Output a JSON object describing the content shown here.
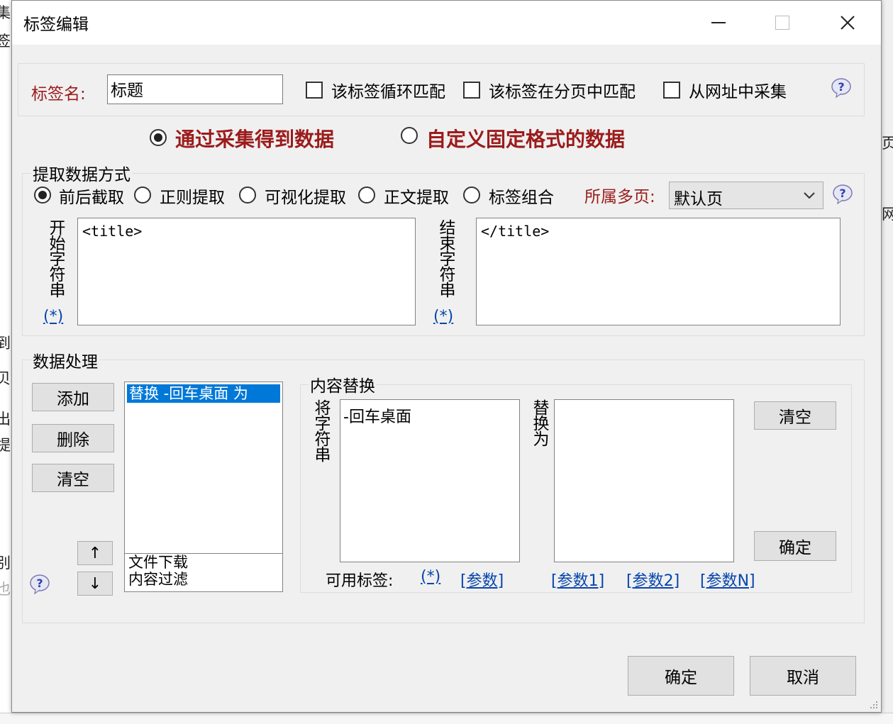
{
  "background": {
    "left_fragments": [
      "集I",
      "签",
      "到",
      "贝",
      "出",
      "提",
      "别",
      "也"
    ],
    "right_fragments": [
      "页",
      "网"
    ]
  },
  "window": {
    "title": "标签编辑",
    "controls": {
      "minimize": "–",
      "maximize": "☐",
      "close": "✕"
    }
  },
  "tag_row": {
    "label": "标签名:",
    "value": "标题",
    "checkboxes": [
      {
        "label": "该标签循环匹配",
        "checked": false
      },
      {
        "label": "该标签在分页中匹配",
        "checked": false
      },
      {
        "label": "从网址中采集",
        "checked": false
      }
    ]
  },
  "mode": {
    "options": [
      {
        "label": "通过采集得到数据",
        "selected": true
      },
      {
        "label": "自定义固定格式的数据",
        "selected": false
      }
    ],
    "accent_color": "#9b1b1b"
  },
  "extract": {
    "group_label": "提取数据方式",
    "methods": [
      {
        "label": "前后截取",
        "selected": true
      },
      {
        "label": "正则提取",
        "selected": false
      },
      {
        "label": "可视化提取",
        "selected": false
      },
      {
        "label": "正文提取",
        "selected": false
      },
      {
        "label": "标签组合",
        "selected": false
      }
    ],
    "page_label": "所属多页:",
    "page_value": "默认页",
    "start_label": "开始字符串",
    "start_value": "<title>",
    "start_link": "(*)",
    "end_label": "结束字符串",
    "end_value": "</title>",
    "end_link": "(*)"
  },
  "processing": {
    "group_label": "数据处理",
    "buttons": {
      "add": "添加",
      "delete": "删除",
      "clear": "清空"
    },
    "rules": [
      "替换 -回车桌面 为"
    ],
    "options": [
      "文件下载",
      "内容过滤"
    ],
    "up_arrow": "↑",
    "down_arrow": "↓",
    "replace": {
      "group_label": "内容替换",
      "find_label": "将字符串",
      "find_value": "-回车桌面",
      "replace_label": "替换为",
      "replace_value": "",
      "clear_button": "清空",
      "ok_button": "确定",
      "tags_label": "可用标签:",
      "tags": [
        "(*)",
        "[参数]",
        "[参数1]",
        "[参数2]",
        "[参数N]"
      ]
    }
  },
  "footer": {
    "ok": "确定",
    "cancel": "取消"
  },
  "colors": {
    "selection": "#0078d7",
    "link": "#0645ad"
  }
}
